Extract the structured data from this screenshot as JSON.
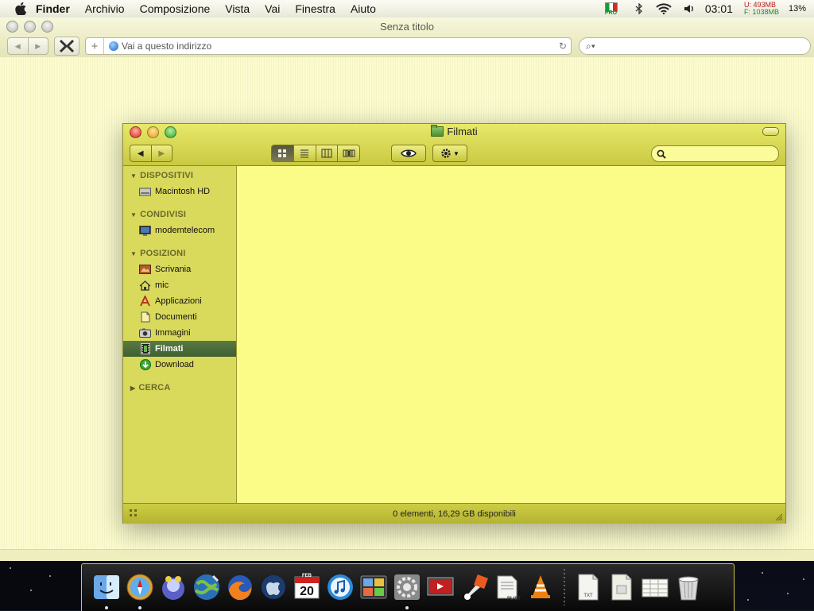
{
  "menubar": {
    "app": "Finder",
    "items": [
      "Archivio",
      "Composizione",
      "Vista",
      "Vai",
      "Finestra",
      "Aiuto"
    ],
    "flag_label": "PRO",
    "clock": "03:01",
    "mem_used": "U:  493MB",
    "mem_free": "F: 1038MB",
    "battery": "13%"
  },
  "browser": {
    "title": "Senza titolo",
    "address_placeholder": "Vai a questo indirizzo"
  },
  "finder": {
    "title": "Filmati",
    "status": "0 elementi, 16,29 GB disponibili",
    "sections": {
      "devices": "DISPOSITIVI",
      "shared": "CONDIVISI",
      "places": "POSIZIONI",
      "search": "CERCA"
    },
    "devices": [
      {
        "label": "Macintosh HD",
        "icon": "hard-drive-icon"
      }
    ],
    "shared": [
      {
        "label": "modemtelecom",
        "icon": "monitor-icon"
      }
    ],
    "places": [
      {
        "label": "Scrivania",
        "icon": "desktop-icon"
      },
      {
        "label": "mic",
        "icon": "home-icon"
      },
      {
        "label": "Applicazioni",
        "icon": "applications-icon"
      },
      {
        "label": "Documenti",
        "icon": "documents-icon"
      },
      {
        "label": "Immagini",
        "icon": "pictures-icon"
      },
      {
        "label": "Filmati",
        "icon": "movies-icon"
      },
      {
        "label": "Download",
        "icon": "download-icon"
      }
    ],
    "selected": "Filmati"
  },
  "dock": {
    "items": [
      {
        "icon": "finder-icon"
      },
      {
        "icon": "safari-icon"
      },
      {
        "icon": "adium-icon"
      },
      {
        "icon": "network-globe-icon"
      },
      {
        "icon": "firefox-icon"
      },
      {
        "icon": "apple-web-icon"
      },
      {
        "icon": "ical-icon",
        "label": "20",
        "month": "FEB"
      },
      {
        "icon": "itunes-icon"
      },
      {
        "icon": "dashboard-icon"
      },
      {
        "icon": "system-preferences-icon"
      },
      {
        "icon": "screen-sharing-icon"
      },
      {
        "icon": "color-picker-icon"
      },
      {
        "icon": "plist-editor-icon",
        "label": "PLIST"
      },
      {
        "icon": "vlc-icon"
      },
      {
        "icon": "txt-document-icon",
        "label": "TXT"
      },
      {
        "icon": "document-icon"
      },
      {
        "icon": "spreadsheet-document-icon"
      },
      {
        "icon": "trash-icon"
      }
    ]
  },
  "colors": {
    "finder_frame": "#d2d250",
    "finder_content": "#fbfb88",
    "sidebar_selected": "#4a6a3a"
  }
}
